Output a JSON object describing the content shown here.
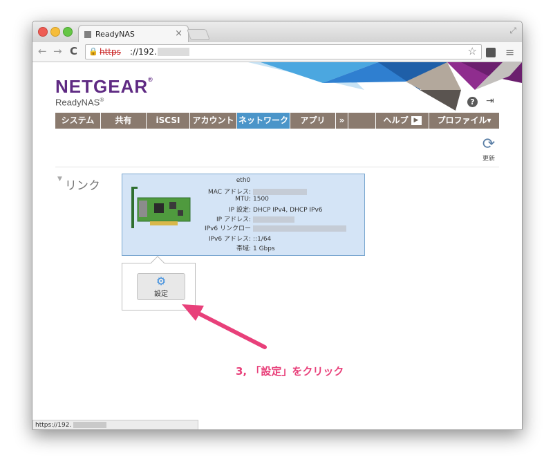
{
  "browser": {
    "tab_title": "ReadyNAS",
    "tab_close": "×",
    "url_scheme": "https",
    "url_host": "://192.",
    "back": "←",
    "forward": "→",
    "reload": "C",
    "star": "☆",
    "menu": "≡",
    "fullscreen": "⤢",
    "status_url": "https://192."
  },
  "header": {
    "logo": "NETGEAR",
    "logo_mark": "®",
    "subbrand": "ReadyNAS",
    "subbrand_mark": "®",
    "help": "?",
    "logout": "⇥"
  },
  "nav": {
    "items": [
      {
        "label": "システム"
      },
      {
        "label": "共有"
      },
      {
        "label": "iSCSI"
      },
      {
        "label": "アカウント"
      },
      {
        "label": "ネットワーク",
        "active": true
      },
      {
        "label": "アプリ"
      },
      {
        "label": "»"
      },
      {
        "label": ""
      },
      {
        "label": "ヘルプ"
      },
      {
        "label": "プロファイル▾"
      }
    ],
    "help_play": "▶"
  },
  "toolbar": {
    "refresh_label": "更新",
    "refresh_icon": "⟳"
  },
  "section": {
    "title": "リンク",
    "arrow": "▼"
  },
  "interface": {
    "name": "eth0",
    "rows": [
      {
        "label": "MAC アドレス:",
        "value": ""
      },
      {
        "label": "MTU:",
        "value": "1500"
      },
      {
        "label": "IP 設定:",
        "value": "DHCP IPv4, DHCP IPv6"
      },
      {
        "label": "IP アドレス:",
        "value": ""
      },
      {
        "label": "IPv6 リンクロー",
        "value": ""
      },
      {
        "label": "IPv6 アドレス:",
        "value": "::1/64"
      },
      {
        "label": "帯域:",
        "value": "1 Gbps"
      }
    ]
  },
  "popover": {
    "settings_label": "設定",
    "gear": "⚙"
  },
  "annotation": {
    "text": "3, 「設定」をクリック"
  },
  "colors": {
    "brand": "#5f2a83",
    "nav_bg": "#8a7a6e",
    "nav_active": "#4b95c9",
    "card_bg": "#d4e4f6",
    "annotation": "#e8407a"
  }
}
